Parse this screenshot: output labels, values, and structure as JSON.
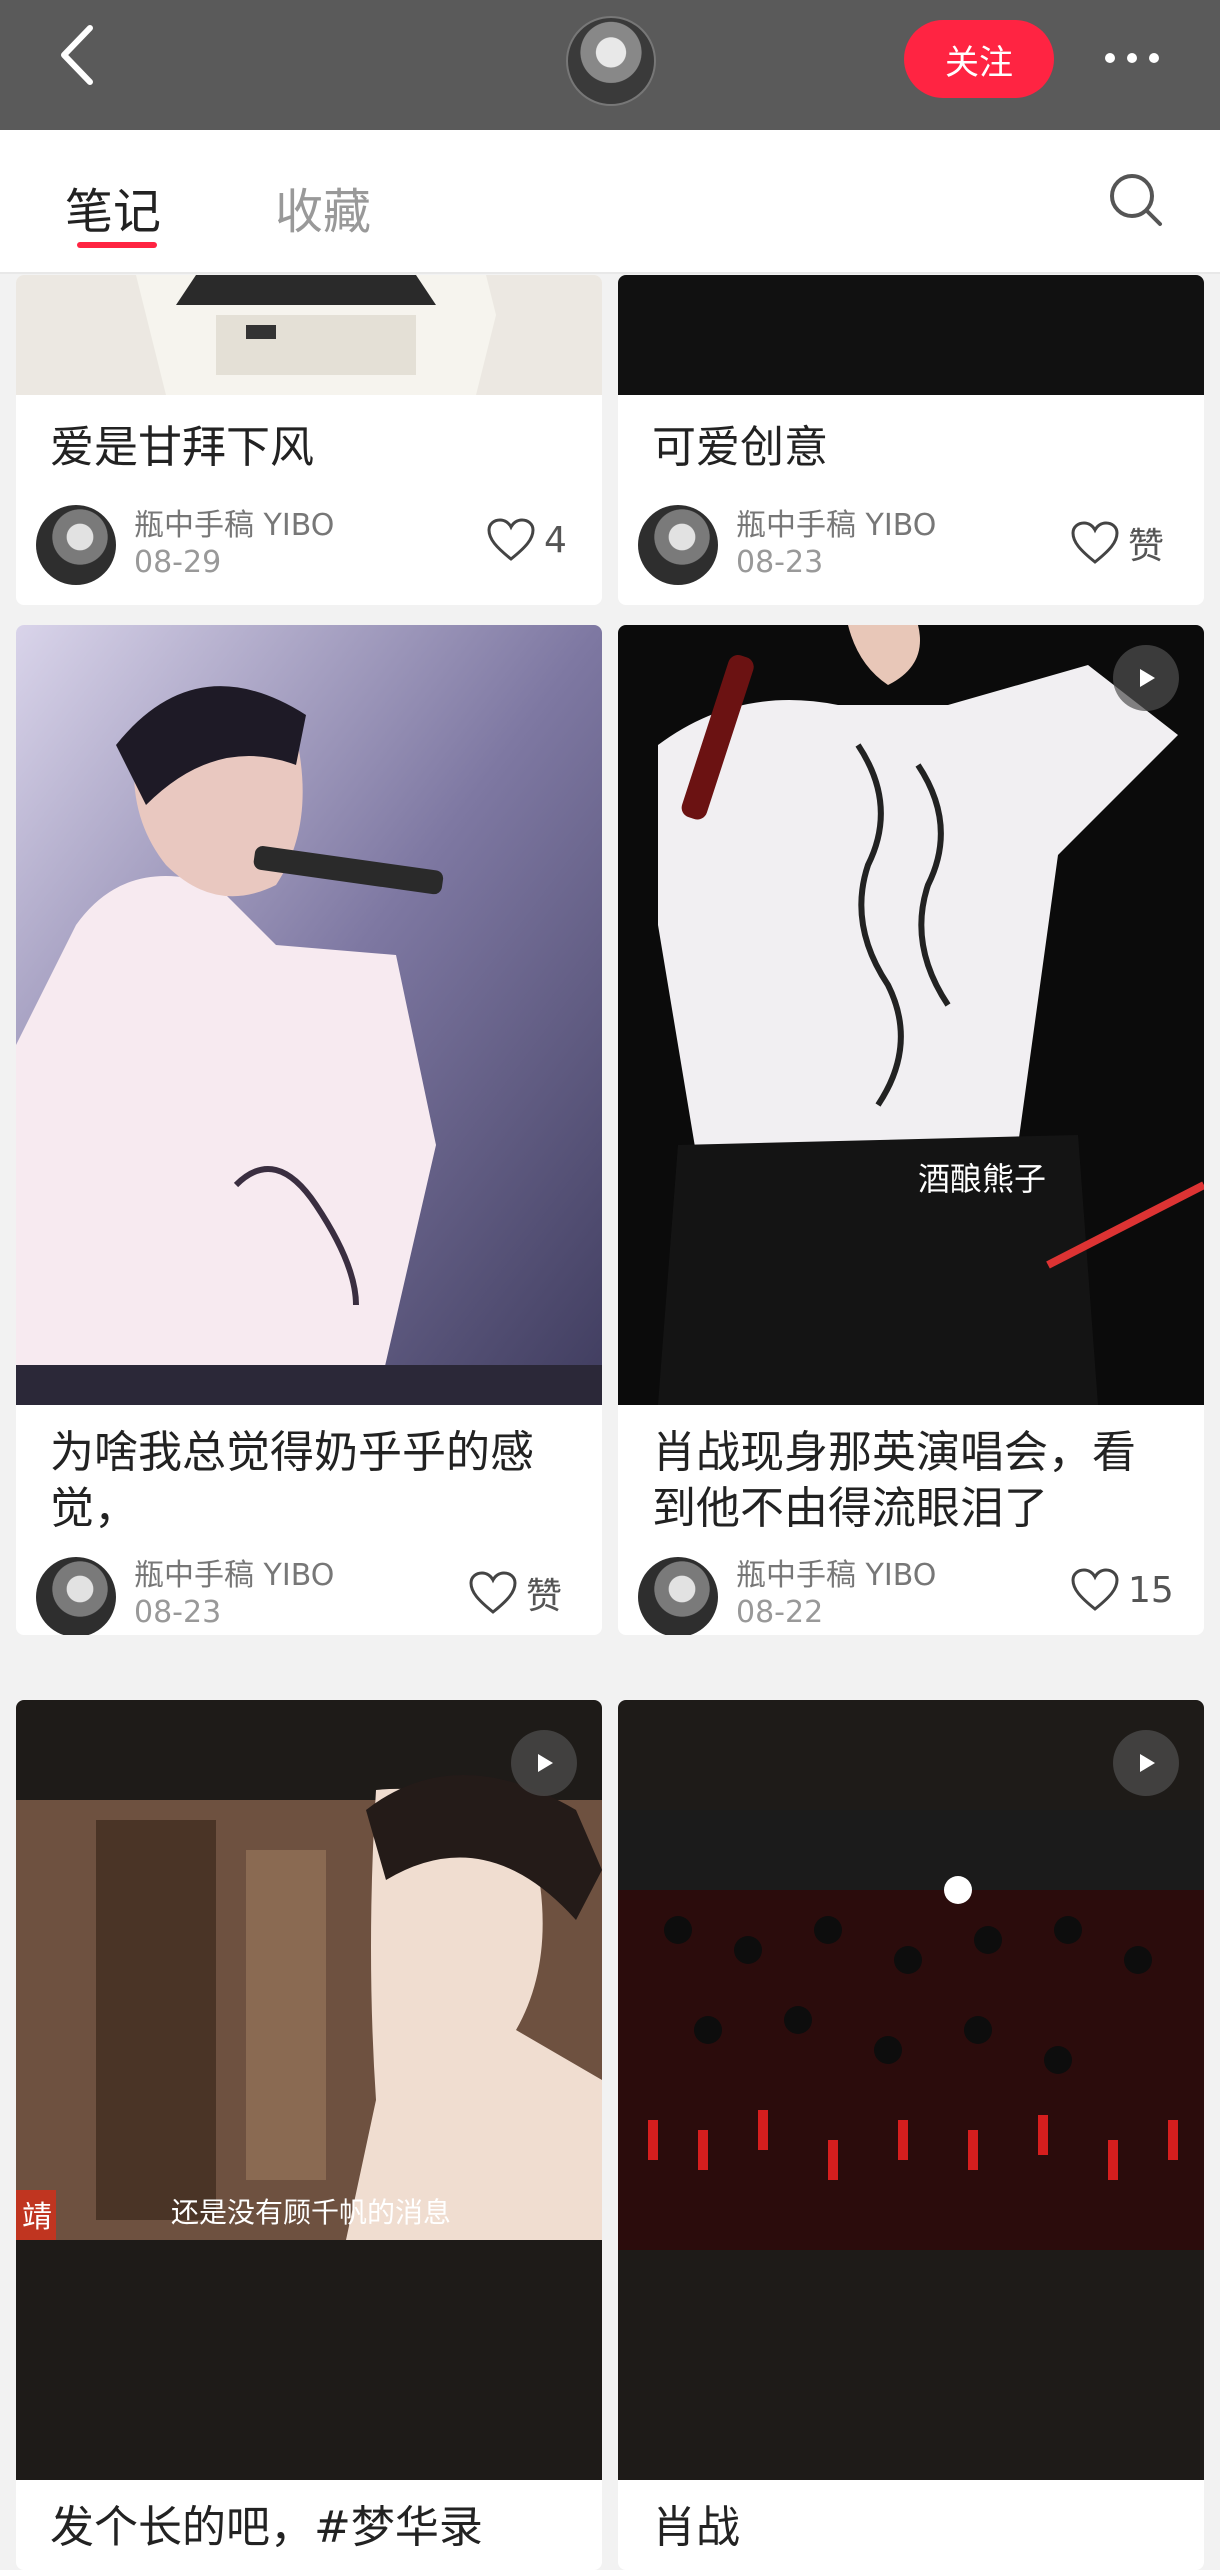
{
  "header": {
    "follow_label": "关注"
  },
  "tabs": [
    {
      "label": "笔记"
    },
    {
      "label": "收藏"
    }
  ],
  "notes": [
    {
      "title": "爱是甘拜下风",
      "author": "瓶中手稿 YIBO",
      "date": "08-29",
      "likes": "4"
    },
    {
      "title": "可爱创意",
      "author": "瓶中手稿 YIBO",
      "date": "08-23",
      "likes": "赞"
    },
    {
      "title": "为啥我总觉得奶乎乎的感觉，",
      "author": "瓶中手稿 YIBO",
      "date": "08-23",
      "likes": "赞"
    },
    {
      "title": "肖战现身那英演唱会，看到他不由得流眼泪了",
      "author": "瓶中手稿 YIBO",
      "date": "08-22",
      "likes": "15",
      "watermark": "酒酿熊子"
    },
    {
      "title": "发个长的吧，#梦华录",
      "subtitle": "还是没有顾千帆的消息",
      "corner_mark": "靖"
    },
    {
      "title": "肖战"
    }
  ],
  "colors": {
    "accent": "#ff2442",
    "topbar": "#5a5a5a"
  }
}
